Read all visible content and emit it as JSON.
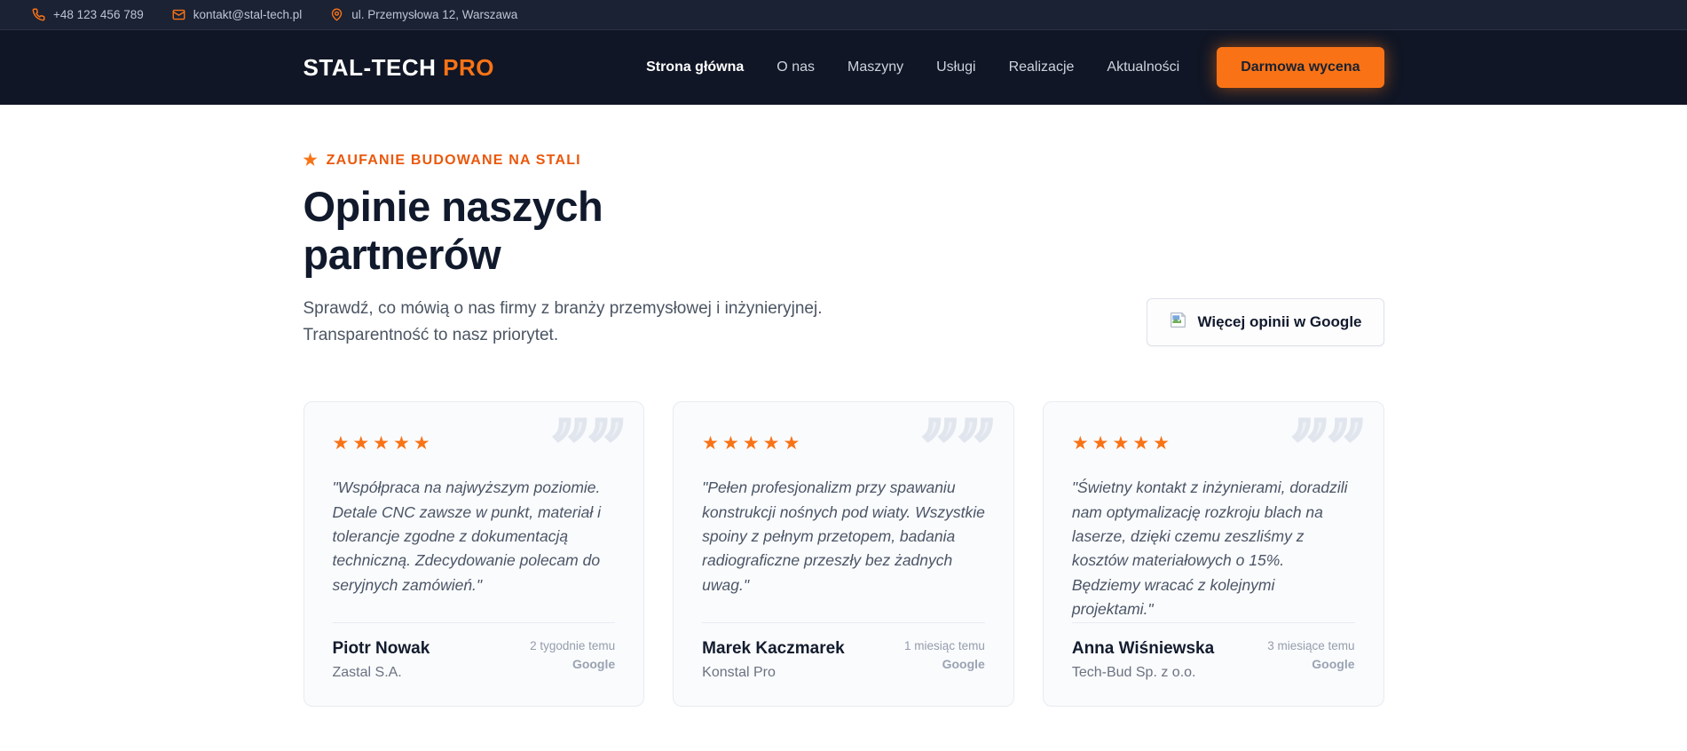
{
  "topbar": {
    "phone": "+48 123 456 789",
    "email": "kontakt@stal-tech.pl",
    "address": "ul. Przemysłowa 12, Warszawa"
  },
  "nav": {
    "logo_part1": "STAL-TECH",
    "logo_part2": "PRO",
    "items": [
      {
        "label": "Strona główna"
      },
      {
        "label": "O nas"
      },
      {
        "label": "Maszyny"
      },
      {
        "label": "Usługi"
      },
      {
        "label": "Realizacje"
      },
      {
        "label": "Aktualności"
      }
    ],
    "cta_label": "Darmowa wycena"
  },
  "reviews": {
    "eyebrow": "ZAUFANIE BUDOWANE NA STALI",
    "title": "Opinie naszych partnerów",
    "subtitle_line1": "Sprawdź, co mówią o nas firmy z branży przemysłowej i inżynieryjnej.",
    "subtitle_line2": "Transparentność to nasz priorytet.",
    "google_button_label": "Więcej opinii w Google",
    "cards": [
      {
        "stars": "★★★★★",
        "quote": "\"Współpraca na najwyższym poziomie. Detale CNC zawsze w punkt, materiał i tolerancje zgodne z dokumentacją techniczną. Zdecydowanie polecam do seryjnych zamówień.\"",
        "name": "Piotr Nowak",
        "company": "Zastal S.A.",
        "time": "2 tygodnie temu",
        "source": "Google"
      },
      {
        "stars": "★★★★★",
        "quote": "\"Pełen profesjonalizm przy spawaniu konstrukcji nośnych pod wiaty. Wszystkie spoiny z pełnym przetopem, badania radiograficzne przeszły bez żadnych uwag.\"",
        "name": "Marek Kaczmarek",
        "company": "Konstal Pro",
        "time": "1 miesiąc temu",
        "source": "Google"
      },
      {
        "stars": "★★★★★",
        "quote": "\"Świetny kontakt z inżynierami, doradzili nam optymalizację rozkroju blach na laserze, dzięki czemu zeszliśmy z kosztów materiałowych o 15%. Będziemy wracać z kolejnymi projektami.\"",
        "name": "Anna Wiśniewska",
        "company": "Tech-Bud Sp. z o.o.",
        "time": "3 miesiące temu",
        "source": "Google"
      }
    ]
  },
  "colors": {
    "accent_orange": "#f97316",
    "header_dark": "#101625",
    "topbar_dark": "#1b2234",
    "heading_navy": "#111a2c"
  }
}
